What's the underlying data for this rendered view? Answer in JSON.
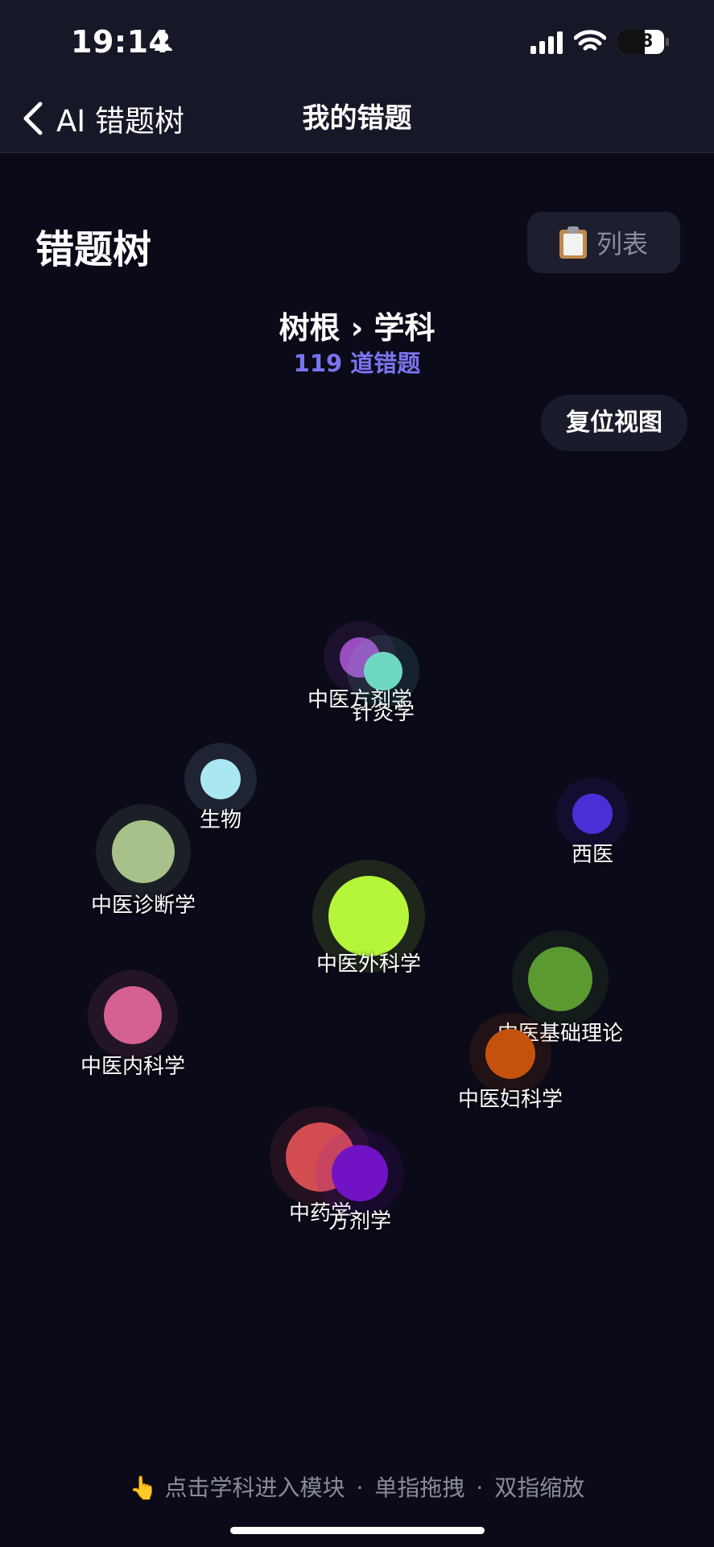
{
  "status": {
    "time": "19:14",
    "battery": "58"
  },
  "nav": {
    "back_label": "AI 错题树",
    "title": "我的错题"
  },
  "page": {
    "title": "错题树",
    "list_button": "列表",
    "breadcrumb": "树根 › 学科",
    "count": "119 道错题",
    "reset_button": "复位视图"
  },
  "nodes": [
    {
      "name": "中医方剂学",
      "color": "#9a4cc0"
    },
    {
      "name": "针灸学",
      "color": "#6fd8c3"
    },
    {
      "name": "生物",
      "color": "#a9e8f0"
    },
    {
      "name": "西医",
      "color": "#4a2fd6"
    },
    {
      "name": "中医诊断学",
      "color": "#a8c08a"
    },
    {
      "name": "中医外科学",
      "color": "#b5f53a"
    },
    {
      "name": "中医基础理论",
      "color": "#5a9a30"
    },
    {
      "name": "中医内科学",
      "color": "#d46190"
    },
    {
      "name": "中医妇科学",
      "color": "#c5520c"
    },
    {
      "name": "中药学",
      "color": "#d24c52"
    },
    {
      "name": "方剂学",
      "color": "#7113c4"
    }
  ],
  "hint": {
    "icon": "pointing-hand-icon",
    "tap": "点击学科进入模块",
    "sep": "·",
    "drag": "单指拖拽",
    "zoom": "双指缩放"
  }
}
